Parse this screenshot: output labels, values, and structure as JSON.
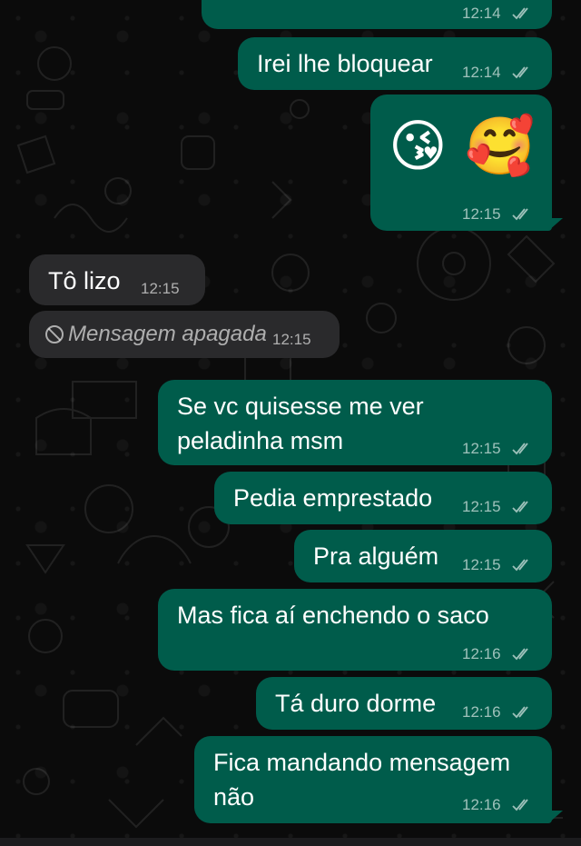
{
  "messages": [
    {
      "id": "m0",
      "dir": "out",
      "text": "",
      "time": "12:14",
      "status": "read"
    },
    {
      "id": "m1",
      "dir": "out",
      "text": "Irei lhe bloquear",
      "time": "12:14",
      "status": "read"
    },
    {
      "id": "m2",
      "dir": "out",
      "text": "😘 🥰",
      "time": "12:15",
      "status": "read"
    },
    {
      "id": "m3",
      "dir": "in",
      "text": "Tô lizo",
      "time": "12:15"
    },
    {
      "id": "m4",
      "dir": "in",
      "text": "Mensagem apagada",
      "time": "12:15",
      "deleted": true
    },
    {
      "id": "m5",
      "dir": "out",
      "text_line1": "Se vc quisesse me ver",
      "text_line2": "peladinha msm",
      "time": "12:15",
      "status": "read"
    },
    {
      "id": "m6",
      "dir": "out",
      "text": "Pedia emprestado",
      "time": "12:15",
      "status": "read"
    },
    {
      "id": "m7",
      "dir": "out",
      "text": "Pra alguém",
      "time": "12:15",
      "status": "read"
    },
    {
      "id": "m8",
      "dir": "out",
      "text": "Mas fica aí enchendo o saco",
      "time": "12:16",
      "status": "read"
    },
    {
      "id": "m9",
      "dir": "out",
      "text": "Tá duro dorme",
      "time": "12:16",
      "status": "read"
    },
    {
      "id": "m10",
      "dir": "out",
      "text_line1": "Fica mandando mensagem",
      "text_line2": "não",
      "time": "12:16",
      "status": "read"
    }
  ],
  "emoji": {
    "kiss": "😘",
    "love": "🥰"
  },
  "icons": {
    "read_receipt": "double-check-icon",
    "deleted": "prohibited-icon"
  },
  "colors": {
    "outgoing": "#005c4b",
    "incoming": "#2a2a2c",
    "background": "#0b0b0b"
  }
}
